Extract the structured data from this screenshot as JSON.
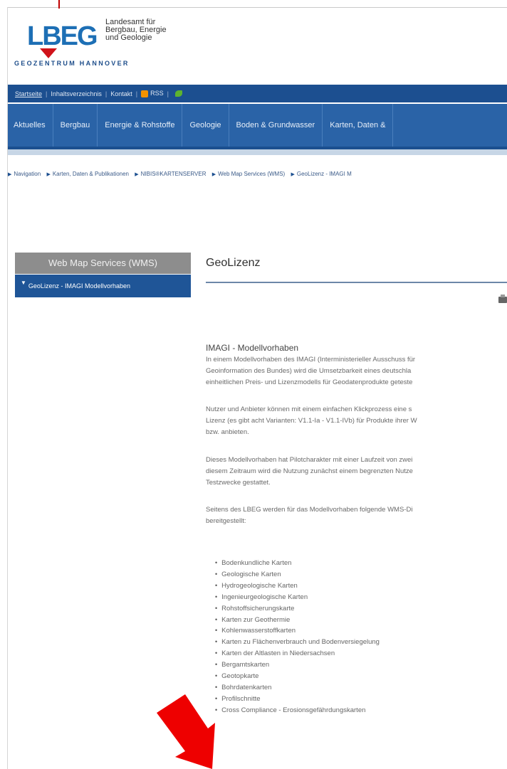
{
  "logo": {
    "mark": "LBEG",
    "text_lines": [
      "Landesamt für",
      "Bergbau, Energie",
      "und Geologie"
    ],
    "subtitle": "GEOZENTRUM HANNOVER"
  },
  "topbar": {
    "home": "Startseite",
    "toc": "Inhaltsverzeichnis",
    "contact": "Kontakt",
    "rss": "RSS"
  },
  "mainnav": [
    "Aktuelles",
    "Bergbau",
    "Energie & Rohstoffe",
    "Geologie",
    "Boden & Grundwasser",
    "Karten, Daten &"
  ],
  "breadcrumb": [
    "Navigation",
    "Karten, Daten & Publikationen",
    "NIBIS®KARTENSERVER",
    "Web Map Services (WMS)",
    "GeoLizenz - IMAGI M"
  ],
  "sidebar": {
    "heading": "Web Map Services (WMS)",
    "item": "GeoLizenz - IMAGI Modellvorhaben"
  },
  "content": {
    "title": "GeoLizenz",
    "section_title": "IMAGI - Modellvorhaben",
    "paragraphs": [
      [
        "In einem Modellvorhaben des IMAGI (Interministerieller Ausschuss für",
        "Geoinformation des Bundes) wird die Umsetzbarkeit eines deutschla",
        "einheitlichen Preis- und Lizenzmodells für Geodatenprodukte geteste"
      ],
      [
        "Nutzer und Anbieter können mit einem einfachen Klickprozess eine s",
        "Lizenz (es gibt acht Varianten: V1.1-Ia - V1.1-IVb) für Produkte ihrer W",
        "bzw. anbieten."
      ],
      [
        "Dieses Modellvorhaben hat Pilotcharakter mit einer Laufzeit von zwei",
        "diesem Zeitraum wird die Nutzung zunächst einem begrenzten Nutze",
        "Testzwecke gestattet."
      ],
      [
        "Seitens des LBEG werden für das Modellvorhaben folgende WMS-Di",
        "bereitgestellt:"
      ]
    ],
    "list": [
      "Bodenkundliche Karten",
      "Geologische Karten",
      "Hydrogeologische Karten",
      "Ingenieurgeologische Karten",
      "Rohstoffsicherungskarte",
      "Karten zur Geothermie",
      "Kohlenwasserstoffkarten",
      "Karten zu Flächenverbrauch und Bodenversiegelung",
      "Karten der Altlasten in Niedersachsen",
      "Bergamtskarten",
      "Geotopkarte",
      "Bohrdatenkarten",
      "Profilschnitte",
      "Cross Compliance - Erosionsgefährdungskarten"
    ]
  },
  "colors": {
    "nav_blue": "#2a63a7",
    "topbar_blue": "#1c4f90",
    "sidebar_grey": "#8d8d8d",
    "annotation_red": "#ee0000"
  }
}
